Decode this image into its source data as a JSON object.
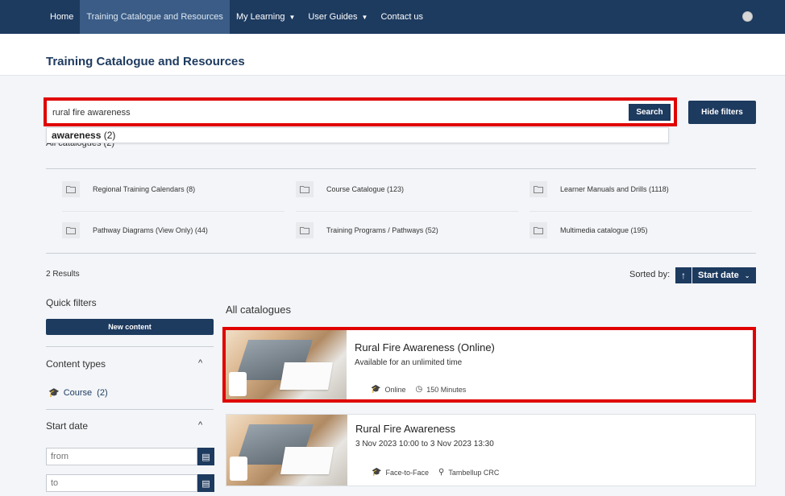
{
  "nav": {
    "items": [
      {
        "label": "Home"
      },
      {
        "label": "Training Catalogue and Resources"
      },
      {
        "label": "My Learning"
      },
      {
        "label": "User Guides"
      },
      {
        "label": "Contact us"
      }
    ]
  },
  "page": {
    "title": "Training Catalogue and Resources"
  },
  "search": {
    "value": "rural fire awareness",
    "button_label": "Search",
    "hide_filters_label": "Hide filters",
    "suggestion_term": "awareness",
    "suggestion_count": " (2)",
    "all_catalogues_peek": "All catalogues (2)"
  },
  "catalogues": [
    {
      "label": "Regional Training Calendars (8)"
    },
    {
      "label": "Course Catalogue (123)"
    },
    {
      "label": "Learner Manuals and Drills (1118)"
    },
    {
      "label": "Pathway Diagrams (View Only) (44)"
    },
    {
      "label": "Training Programs / Pathways (52)"
    },
    {
      "label": "Multimedia catalogue (195)"
    }
  ],
  "results": {
    "count_label": "2 Results",
    "sorted_by_label": "Sorted by:",
    "sort_value": "Start date",
    "heading": "All catalogues",
    "items": [
      {
        "title": "Rural Fire Awareness (Online)",
        "subtitle": "Available for an unlimited time",
        "delivery": "Online",
        "extra": "150 Minutes"
      },
      {
        "title": "Rural Fire Awareness",
        "subtitle": "3 Nov 2023 10:00 to 3 Nov 2023 13:30",
        "delivery": "Face-to-Face",
        "extra": "Tambellup CRC"
      }
    ]
  },
  "sidebar": {
    "quick_filters_title": "Quick filters",
    "new_content_label": "New content",
    "content_types_title": "Content types",
    "course_label": "Course",
    "course_count": "(2)",
    "start_date_title": "Start date",
    "from_placeholder": "from",
    "to_placeholder": "to"
  },
  "colors": {
    "primary": "#1d3a5f",
    "highlight": "#e00000"
  }
}
